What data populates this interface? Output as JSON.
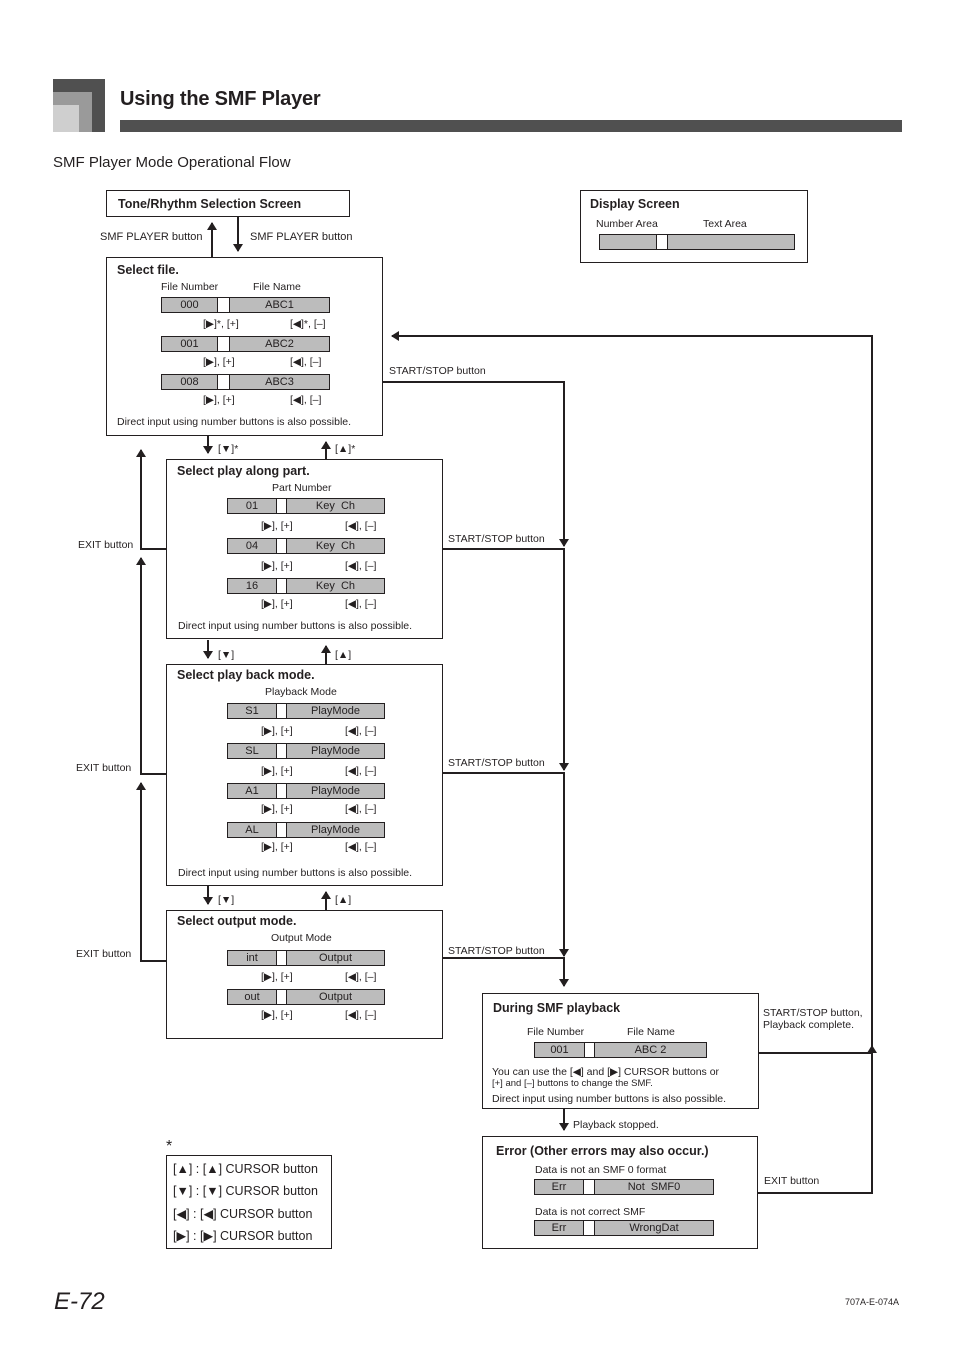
{
  "header": {
    "title": "Using the SMF Player",
    "subtitle": "SMF Player Mode Operational Flow"
  },
  "tone_rhythm": {
    "title": "Tone/Rhythm Selection Screen",
    "left_label": "SMF PLAYER button",
    "right_label": "SMF PLAYER button"
  },
  "display_screen": {
    "title": "Display Screen",
    "number_area_label": "Number Area",
    "text_area_label": "Text Area"
  },
  "select_file": {
    "title": "Select file.",
    "col_number": "File Number",
    "col_name": "File Name",
    "rows": [
      {
        "num": "000",
        "text": "ABC1"
      },
      {
        "num": "001",
        "text": "ABC2"
      },
      {
        "num": "008",
        "text": "ABC3"
      }
    ],
    "down_labels": [
      "[▶]*, [+]",
      "[▶], [+]",
      "[▶], [+]"
    ],
    "up_labels": [
      "[◀]*, [–]",
      "[◀], [–]",
      "[◀], [–]"
    ],
    "note": "Direct input using number buttons is also possible."
  },
  "transitions": {
    "file_to_part_down": "[▼]*",
    "file_to_part_up": "[▲]*",
    "part_to_mode_down": "[▼]",
    "part_to_mode_up": "[▲]",
    "mode_to_output_down": "[▼]",
    "mode_to_output_up": "[▲]",
    "start_stop": "START/STOP button",
    "exit": "EXIT button",
    "playback_stopped": "Playback stopped.",
    "start_stop_complete_line1": "START/STOP button,",
    "start_stop_complete_line2": "Playback complete."
  },
  "select_part": {
    "title": "Select play along part.",
    "col_label": "Part Number",
    "rows": [
      {
        "num": "01",
        "text": "Key  Ch"
      },
      {
        "num": "04",
        "text": "Key  Ch"
      },
      {
        "num": "16",
        "text": "Key  Ch"
      }
    ],
    "down_labels": [
      "[▶], [+]",
      "[▶], [+]",
      "[▶], [+]"
    ],
    "up_labels": [
      "[◀], [–]",
      "[◀], [–]",
      "[◀], [–]"
    ],
    "note": "Direct input using number buttons is also possible."
  },
  "select_mode": {
    "title": "Select play back mode.",
    "col_label": "Playback Mode",
    "rows": [
      {
        "num": "S1",
        "text": "PlayMode"
      },
      {
        "num": "SL",
        "text": "PlayMode"
      },
      {
        "num": "A1",
        "text": "PlayMode"
      },
      {
        "num": "AL",
        "text": "PlayMode"
      }
    ],
    "down_labels": [
      "[▶], [+]",
      "[▶], [+]",
      "[▶], [+]",
      "[▶], [+]"
    ],
    "up_labels": [
      "[◀], [–]",
      "[◀], [–]",
      "[◀], [–]",
      "[◀], [–]"
    ],
    "note": "Direct input using number buttons is also possible."
  },
  "select_output": {
    "title": "Select output mode.",
    "col_label": "Output Mode",
    "rows": [
      {
        "num": "int",
        "text": "Output"
      },
      {
        "num": "out",
        "text": "Output"
      }
    ],
    "down_labels": [
      "[▶], [+]",
      "[▶], [+]"
    ],
    "up_labels": [
      "[◀], [–]",
      "[◀], [–]"
    ]
  },
  "playback": {
    "title": "During SMF playback",
    "col_number": "File Number",
    "col_name": "File Name",
    "num": "001",
    "text": "ABC 2",
    "note1_line1": "You can use the [◀] and [▶] CURSOR buttons or",
    "note1_line2": "[+] and [–] buttons to change the SMF.",
    "note2": "Direct input using number buttons is also possible."
  },
  "error": {
    "title": "Error (Other errors may also occur.)",
    "items": [
      {
        "caption": "Data is not an SMF 0 format",
        "num": "Err",
        "text": "Not  SMF0"
      },
      {
        "caption": "Data is not correct SMF",
        "num": "Err",
        "text": "WrongDat"
      }
    ]
  },
  "legend": {
    "asterisk": "*",
    "rows": [
      "[▲] :  [▲] CURSOR button",
      "[▼] :  [▼] CURSOR button",
      "[◀] :  [◀] CURSOR button",
      "[▶] :  [▶] CURSOR button"
    ]
  },
  "footer": {
    "page_number": "E-72",
    "doc_code": "707A-E-074A"
  }
}
